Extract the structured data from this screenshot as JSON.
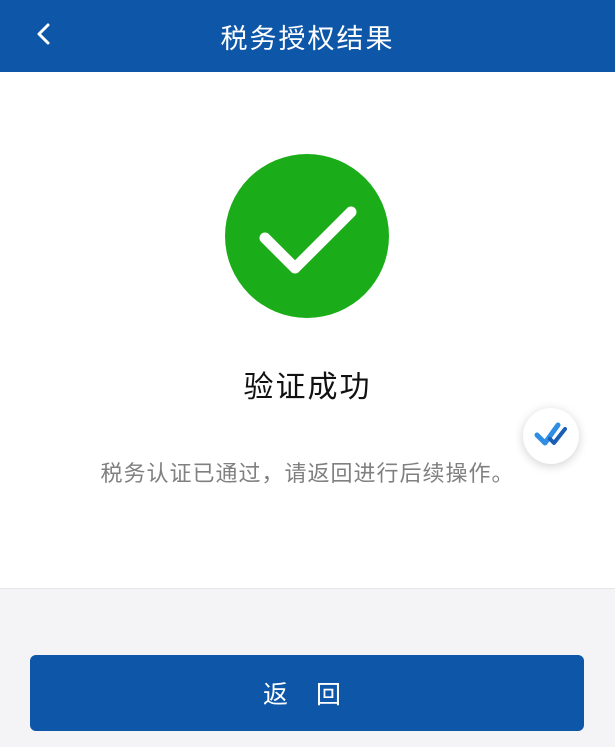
{
  "header": {
    "title": "税务授权结果",
    "back_icon": "chevron-left-icon"
  },
  "result": {
    "status_icon": "check-circle-icon",
    "title": "验证成功",
    "description": "税务认证已通过，请返回进行后续操作。"
  },
  "floating_badge": {
    "icon": "double-check-icon"
  },
  "footer": {
    "return_label": "返 回"
  },
  "colors": {
    "brand": "#0d56a8",
    "success": "#1aad19",
    "background": "#f4f4f6",
    "text_secondary": "#808080"
  }
}
